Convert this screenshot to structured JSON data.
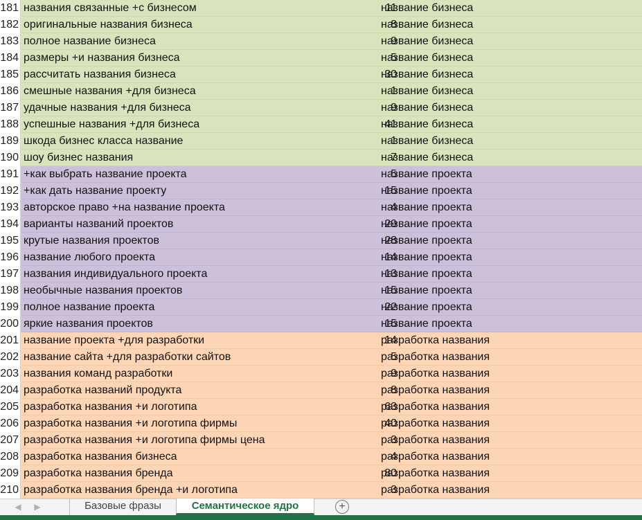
{
  "colors": {
    "green_band": "#d8e4bc",
    "purple_band": "#ccc0da",
    "orange_band": "#fcd5b4",
    "accent": "#217346"
  },
  "rows": [
    {
      "num": "181",
      "phrase": "названия связанные +с бизнесом",
      "count": "11",
      "group": "название бизнеса",
      "band": "green"
    },
    {
      "num": "182",
      "phrase": "оригинальные названия бизнеса",
      "count": "8",
      "group": "название бизнеса",
      "band": "green"
    },
    {
      "num": "183",
      "phrase": "полное название бизнеса",
      "count": "9",
      "group": "название бизнеса",
      "band": "green"
    },
    {
      "num": "184",
      "phrase": "размеры +и названия бизнеса",
      "count": "5",
      "group": "название бизнеса",
      "band": "green"
    },
    {
      "num": "185",
      "phrase": "рассчитать названия бизнеса",
      "count": "30",
      "group": "название бизнеса",
      "band": "green"
    },
    {
      "num": "186",
      "phrase": "смешные названия +для бизнеса",
      "count": "1",
      "group": "название бизнеса",
      "band": "green"
    },
    {
      "num": "187",
      "phrase": "удачные названия +для бизнеса",
      "count": "9",
      "group": "название бизнеса",
      "band": "green"
    },
    {
      "num": "188",
      "phrase": "успешные названия +для бизнеса",
      "count": "41",
      "group": "название бизнеса",
      "band": "green"
    },
    {
      "num": "189",
      "phrase": "шкода бизнес класса название",
      "count": "1",
      "group": "название бизнеса",
      "band": "green"
    },
    {
      "num": "190",
      "phrase": "шоу бизнес названия",
      "count": "7",
      "group": "название бизнеса",
      "band": "green"
    },
    {
      "num": "191",
      "phrase": "+как выбрать название проекта",
      "count": "5",
      "group": "название проекта",
      "band": "purple"
    },
    {
      "num": "192",
      "phrase": "+как дать название проекту",
      "count": "15",
      "group": "название проекта",
      "band": "purple"
    },
    {
      "num": "193",
      "phrase": "авторское право +на название проекта",
      "count": "4",
      "group": "название проекта",
      "band": "purple"
    },
    {
      "num": "194",
      "phrase": "варианты названий проектов",
      "count": "29",
      "group": "название проекта",
      "band": "purple"
    },
    {
      "num": "195",
      "phrase": "крутые названия проектов",
      "count": "28",
      "group": "название проекта",
      "band": "purple"
    },
    {
      "num": "196",
      "phrase": "название любого проекта",
      "count": "14",
      "group": "название проекта",
      "band": "purple"
    },
    {
      "num": "197",
      "phrase": "названия индивидуального проекта",
      "count": "13",
      "group": "название проекта",
      "band": "purple"
    },
    {
      "num": "198",
      "phrase": "необычные названия проектов",
      "count": "15",
      "group": "название проекта",
      "band": "purple"
    },
    {
      "num": "199",
      "phrase": "полное название проекта",
      "count": "22",
      "group": "название проекта",
      "band": "purple"
    },
    {
      "num": "200",
      "phrase": "яркие названия проектов",
      "count": "15",
      "group": "название проекта",
      "band": "purple"
    },
    {
      "num": "201",
      "phrase": "название проекта +для разработки",
      "count": "14",
      "group": "разработка названия",
      "band": "orange"
    },
    {
      "num": "202",
      "phrase": "название сайта +для разработки сайтов",
      "count": "5",
      "group": "разработка названия",
      "band": "orange"
    },
    {
      "num": "203",
      "phrase": "названия команд разработки",
      "count": "9",
      "group": "разработка названия",
      "band": "orange"
    },
    {
      "num": "204",
      "phrase": "разработка названий продукта",
      "count": "8",
      "group": "разработка названия",
      "band": "orange"
    },
    {
      "num": "205",
      "phrase": "разработка названия +и логотипа",
      "count": "63",
      "group": "разработка названия",
      "band": "orange"
    },
    {
      "num": "206",
      "phrase": "разработка названия +и логотипа фирмы",
      "count": "40",
      "group": "разработка названия",
      "band": "orange"
    },
    {
      "num": "207",
      "phrase": "разработка названия +и логотипа фирмы цена",
      "count": "3",
      "group": "разработка названия",
      "band": "orange"
    },
    {
      "num": "208",
      "phrase": "разработка названия бизнеса",
      "count": "4",
      "group": "разработка названия",
      "band": "orange"
    },
    {
      "num": "209",
      "phrase": "разработка названия бренда",
      "count": "80",
      "group": "разработка названия",
      "band": "orange"
    },
    {
      "num": "210",
      "phrase": "разработка названия бренда +и логотипа",
      "count": "3",
      "group": "разработка названия",
      "band": "orange"
    }
  ],
  "tabs": {
    "nav_prev": "◀",
    "nav_next": "▶",
    "sheet1": "Базовые фразы",
    "sheet2": "Семантическое ядро",
    "add": "+"
  }
}
